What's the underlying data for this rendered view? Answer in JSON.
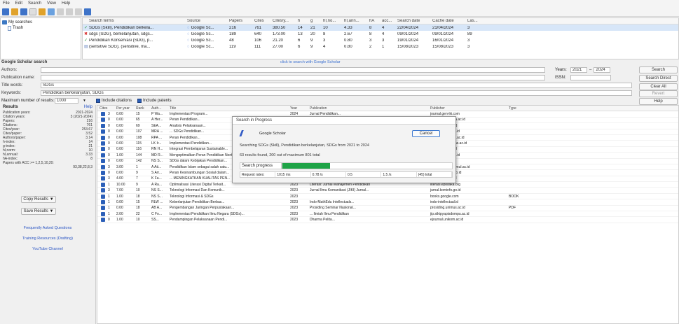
{
  "menu": [
    "File",
    "Edit",
    "Search",
    "View",
    "Help"
  ],
  "tree": {
    "root": "My searches",
    "child": "Trash"
  },
  "queries": {
    "columns": [
      "Search terms",
      "Source",
      "Papers",
      "Cites",
      "Cites/y...",
      "h",
      "g",
      "hI,no...",
      "hI,ann...",
      "hA",
      "acc...",
      "Search date",
      "Cache date",
      "Las..."
    ],
    "rows": [
      {
        "status": "ok",
        "cells": [
          "SDGs (Skill), Pendidikan berkela...",
          "Google Sc...",
          "216",
          "761",
          "380.50",
          "14",
          "21",
          "10",
          "4.33",
          "8",
          "4",
          "22/04/2024",
          "21/04/2024",
          "3"
        ],
        "selected": true
      },
      {
        "status": "bad",
        "cells": [
          "sdgs (SDG), berkelanjutan, sdgs...",
          "Google Sc...",
          "189",
          "640",
          "173.00",
          "13",
          "20",
          "8",
          "2.67",
          "8",
          "4",
          "09/01/2024",
          "09/01/2024",
          "89"
        ],
        "selected": false
      },
      {
        "status": "ok",
        "cells": [
          "Pendidikan Konservasi (SDG), p...",
          "Google Sc...",
          "48",
          "106",
          "21.20",
          "6",
          "9",
          "3",
          "0.80",
          "3",
          "3",
          "19/01/2024",
          "16/01/2024",
          "3"
        ],
        "selected": false
      },
      {
        "status": "doc",
        "cells": [
          "(sensitive SDG), (sensitive, ma...",
          "Google Sc...",
          "119",
          "111",
          "27.00",
          "6",
          "9",
          "4",
          "0.80",
          "2",
          "1",
          "15/08/2023",
          "15/08/2023",
          "3"
        ],
        "selected": false
      }
    ]
  },
  "form": {
    "title": "Google Scholar search",
    "click_hint": "click to search with Google Scholar",
    "authors_label": "Authors:",
    "publication_label": "Publication name:",
    "title_words_label": "Title words:",
    "title_words_value": "SDGs",
    "keywords_label": "Keywords:",
    "keywords_value": "Pendidikan berkelanjutan, SDGs",
    "max_results_label": "Maximum number of results:",
    "max_results_value": "1000",
    "include_citations": "Include citations",
    "include_patents": "Include patents",
    "years_label": "Years:",
    "year_from": "2021",
    "year_to": "2024",
    "issn_label": "ISSN:",
    "search_btn": "Search",
    "search_direct_btn": "Search Direct",
    "clear_all_btn": "Clear All",
    "revert_btn": "Revert",
    "help_btn": "Help"
  },
  "metrics": {
    "title": "Results",
    "help": "Help",
    "items": [
      {
        "label": "Publication years:",
        "value": "2021-2024"
      },
      {
        "label": "Citation years:",
        "value": "3 (2021-2024)"
      },
      {
        "label": "Papers:",
        "value": "216"
      },
      {
        "label": "Citations:",
        "value": "761"
      },
      {
        "label": "Cites/year:",
        "value": "253.67"
      },
      {
        "label": "Cites/paper:",
        "value": "3.52"
      },
      {
        "label": "Authors/paper:",
        "value": "3.14"
      },
      {
        "label": "h-index:",
        "value": "14"
      },
      {
        "label": "g-index:",
        "value": "21"
      },
      {
        "label": "hI,norm:",
        "value": "10"
      },
      {
        "label": "hI,annual:",
        "value": "3.33"
      },
      {
        "label": "hA-index:",
        "value": "8"
      },
      {
        "label": "Papers with ACC >= 1,2,5,10,20:",
        "value": ""
      },
      {
        "label": "",
        "value": "93,38,22,8,3"
      }
    ],
    "copy_btn": "Copy Results",
    "save_btn": "Save Results",
    "faq_link": "Frequently Asked Questions",
    "training_link": "Training Resources (Drafting)",
    "youtube_link": "YouTube Channel"
  },
  "results": {
    "columns": [
      "Cites",
      "Per year",
      "Rank",
      "Auth...",
      "Title",
      "Year",
      "Publication",
      "Publisher",
      "Type"
    ],
    "rows": [
      [
        "3",
        "0.00",
        "15",
        "P Wa...",
        "Implementasi Program...",
        "2024",
        "Jurnal Pendidikan...",
        "journal.gen-iki.com",
        ""
      ],
      [
        "0",
        "0.00",
        "65",
        "A Her...",
        "Peran Pendidikan...",
        "2024",
        "Jurnal Ilmiah...",
        "ejournal.uin-suka.ac.id",
        ""
      ],
      [
        "0",
        "0.00",
        "69",
        "SEA...",
        "Analisis Pelaksanaan...",
        "2024",
        "Jurnal Edukasi...",
        "ejournal.org.ac.id",
        ""
      ],
      [
        "0",
        "0.00",
        "107",
        "MRA ...",
        "... SDGs Pendidikan...",
        "2023",
        "Jurnal Pengabdian...",
        "journal.unpas.ac.id",
        ""
      ],
      [
        "0",
        "0.00",
        "108",
        "RPA ...",
        "Peran Pendidikan...",
        "2023",
        "Jurnal Inovasi...",
        "repository.unesa.ac.id",
        ""
      ],
      [
        "0",
        "0.00",
        "115",
        "LK Ir...",
        "Implementasi Pendidikan...",
        "2024",
        "Jurnal Basicedu...",
        "journal.universitas.ac.id",
        ""
      ],
      [
        "0",
        "0.00",
        "116",
        "RN H...",
        "Integrasi Pembelajaran Sustainable...",
        "2024",
        "PROPHET",
        "ejournal.uip.ac.id",
        ""
      ],
      [
        "0",
        "1.00",
        "144",
        "MD R...",
        "Mengoptimalkan Peran Pendidikan Nonformal...",
        "2024",
        "Pedagogical Journal...",
        "journal.unpad.ac.id",
        ""
      ],
      [
        "0",
        "0.00",
        "142",
        "NS S...",
        "SDGs dalam Kebijakan Pendidikan...",
        "2024",
        "The Journal...",
        "jurnal.uin.com",
        ""
      ],
      [
        "3",
        "3.00",
        "1",
        "A Ati...",
        "Pendidikan Islam sebagai salah satu...",
        "2023",
        "Jurnal Pendidikan Islam Al-Ilmi",
        "jurnal.unismuhalmul.ac.id",
        ""
      ],
      [
        "0",
        "0.00",
        "9",
        "S Arr...",
        "Peran Kesinambungan Sosial dalam...",
        "2023",
        "Jurnal Ekonomi dan...",
        "sinta.ristekbrin.go.id",
        ""
      ],
      [
        "3",
        "4.00",
        "7",
        "K Fa...",
        "... MENINGKATKAN KUALITAS PEN...",
        "2023",
        "... Jurnal Studi Pendidikan dan...",
        "journal.stitq.ac.id",
        ""
      ],
      [
        "1",
        "10.00",
        "9",
        "A Ra...",
        "Optimalisasi Literasi Digital Terkait...",
        "2023",
        "Literasi: Jurnal Manajemen Pendidikan",
        "literasi.epistaka.org",
        ""
      ],
      [
        "3",
        "7.00",
        "10",
        "NS S...",
        "Teknologi Informasi Dan Komunik...",
        "2023",
        "Jurnal Ilmu Komunikasi (JIKI) Jurnal...",
        "jurnal.kominfo.go.id",
        ""
      ],
      [
        "1",
        "1.00",
        "18",
        "NS S...",
        "Teknologi Informasi & SDGs",
        "2023",
        "",
        "books.google.com",
        "BOOK"
      ],
      [
        "1",
        "0.00",
        "15",
        "RLW ...",
        "Keberlanjutan Pendidikan Berbas...",
        "2023",
        "Indo-MathEdu Intellectuals...",
        "indo-intellectual.id",
        ""
      ],
      [
        "1",
        "0.00",
        "18",
        "AB A...",
        "Pengembangan Jaringan Perpustakaan...",
        "2023",
        "Prosiding Seminar Nasional...",
        "prosiding.unimus.ac.id",
        "PDF"
      ],
      [
        "1",
        "2.00",
        "22",
        "C Fo...",
        "Implementasi Pendidikan Ilmu Negara (SDGs)...",
        "2023",
        "... Ilmiah Ilmu Pendidikan",
        "jip.stkipyapisdompu.ac.id",
        ""
      ],
      [
        "0",
        "1.00",
        "10",
        "SS...",
        "Pendampingan Pelaksanaan Pendi...",
        "2023",
        "Dharma Pelita...",
        "ejournal.unikom.ac.id",
        ""
      ]
    ]
  },
  "dialog": {
    "title": "Search in Progress",
    "logo": "//",
    "source": "Google Scholar",
    "cancel": "Cancel",
    "searching": "Searching SDGs (Skill), Pendidikan berkelanjutan, SDGs from 2021 to 2024",
    "found": "63 results found, 200 out of maximum 801 total",
    "progress_label": "Search progress",
    "progress_fraction": 0.28,
    "stats_label": "Request rates:",
    "stats": [
      "1015 ms",
      "0.78 /s",
      "0.5",
      "1.5 /s",
      "(45) total"
    ]
  }
}
